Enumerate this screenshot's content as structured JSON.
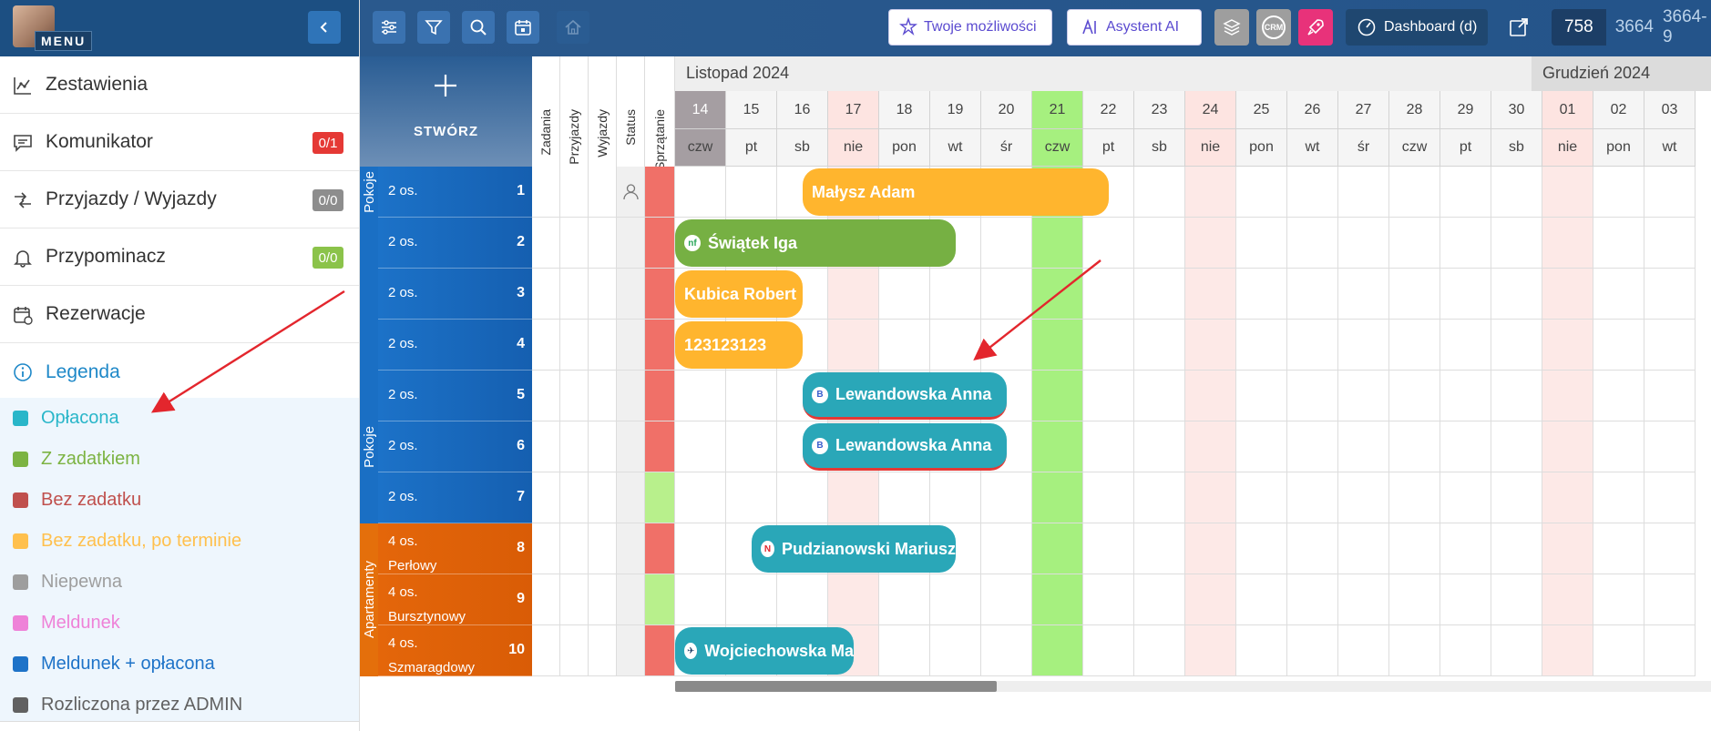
{
  "sidebar": {
    "menu_label": "MENU",
    "nav": [
      {
        "label": "Zestawienia",
        "icon": "chart-icon",
        "badge": ""
      },
      {
        "label": "Komunikator",
        "icon": "chat-icon",
        "badge": "0/1",
        "badge_color": "#e53935"
      },
      {
        "label": "Przyjazdy / Wyjazdy",
        "icon": "arrivals-icon",
        "badge": "0/0",
        "badge_color": "#8d8d8d"
      },
      {
        "label": "Przypominacz",
        "icon": "bell-icon",
        "badge": "0/0",
        "badge_color": "#8bc34a"
      },
      {
        "label": "Rezerwacje",
        "icon": "calendar-icon",
        "badge": ""
      }
    ],
    "legend_title": "Legenda",
    "legend": [
      {
        "label": "Opłacona",
        "color": "#29b6c9"
      },
      {
        "label": "Z zadatkiem",
        "color": "#7cb342"
      },
      {
        "label": "Bez zadatku",
        "color": "#c0504d"
      },
      {
        "label": "Bez zadatku, po terminie",
        "color": "#ffc04d"
      },
      {
        "label": "Niepewna",
        "color": "#9e9e9e"
      },
      {
        "label": "Meldunek",
        "color": "#ee82d8"
      },
      {
        "label": "Meldunek + opłacona",
        "color": "#1e73c8"
      },
      {
        "label": "Rozliczona przez ADMIN",
        "color": "#616161"
      }
    ]
  },
  "topbar": {
    "opportunities_label": "Twoje możliwości",
    "assistant_label": "Asystent AI",
    "crm_label": "CRM",
    "dashboard_label": "Dashboard (d)",
    "counters": [
      "758",
      "3664",
      "3664-9"
    ]
  },
  "calendar": {
    "create_label": "STWÓRZ",
    "side_columns": [
      "Zadania",
      "Przyjazdy",
      "Wyjazdy",
      "Status",
      "Sprzątanie"
    ],
    "months": [
      {
        "label": "Listopad 2024"
      },
      {
        "label": "Grudzień 2024"
      }
    ],
    "dates": [
      "14",
      "15",
      "16",
      "17",
      "18",
      "19",
      "20",
      "21",
      "22",
      "23",
      "24",
      "25",
      "26",
      "27",
      "28",
      "29",
      "30",
      "01",
      "02",
      "03"
    ],
    "weekdays": [
      "czw",
      "pt",
      "sb",
      "nie",
      "pon",
      "wt",
      "śr",
      "czw",
      "pt",
      "sb",
      "nie",
      "pon",
      "wt",
      "śr",
      "czw",
      "pt",
      "sb",
      "nie",
      "pon",
      "wt"
    ],
    "groups": [
      {
        "label": "Pokoje"
      },
      {
        "label": "Pokoje"
      },
      {
        "label": "Apartamenty"
      }
    ],
    "rooms": [
      {
        "cap": "2 os.",
        "name": "",
        "num": "1",
        "clean": "#f07068"
      },
      {
        "cap": "2 os.",
        "name": "",
        "num": "2",
        "clean": "#f07068"
      },
      {
        "cap": "2 os.",
        "name": "",
        "num": "3",
        "clean": "#f07068"
      },
      {
        "cap": "2 os.",
        "name": "",
        "num": "4",
        "clean": "#f07068"
      },
      {
        "cap": "2 os.",
        "name": "",
        "num": "5",
        "clean": "#f07068"
      },
      {
        "cap": "2 os.",
        "name": "",
        "num": "6",
        "clean": "#f07068"
      },
      {
        "cap": "2 os.",
        "name": "",
        "num": "7",
        "clean": "#b8f08c"
      },
      {
        "cap": "4 os.",
        "name": "Perłowy",
        "num": "8",
        "clean": "#f07068"
      },
      {
        "cap": "4 os.",
        "name": "Bursztynowy",
        "num": "9",
        "clean": "#b8f08c"
      },
      {
        "cap": "4 os.",
        "name": "Szmaragdowy",
        "num": "10",
        "clean": "#f07068"
      }
    ],
    "reservations": [
      {
        "guest": "Małysz Adam",
        "room": 0,
        "start": 2.5,
        "end": 8.5,
        "color": "#ffb52e",
        "source": ""
      },
      {
        "guest": "Świątek Iga",
        "room": 1,
        "start": 0,
        "end": 5.5,
        "color": "#76b043",
        "source": "nf"
      },
      {
        "guest": "Kubica Robert",
        "room": 2,
        "start": 0,
        "end": 2.5,
        "color": "#ffb52e",
        "source": ""
      },
      {
        "guest": "123123123",
        "room": 3,
        "start": 0,
        "end": 2.5,
        "color": "#ffb52e",
        "source": ""
      },
      {
        "guest": "Lewandowska Anna",
        "room": 4,
        "start": 2.5,
        "end": 6.5,
        "color": "#2aa7b8",
        "source": "B"
      },
      {
        "guest": "Lewandowska Anna",
        "room": 5,
        "start": 2.5,
        "end": 6.5,
        "color": "#2aa7b8",
        "source": "B"
      },
      {
        "guest": "Pudzianowski Mariusz",
        "room": 7,
        "start": 1.5,
        "end": 5.5,
        "color": "#2aa7b8",
        "source": "N"
      },
      {
        "guest": "Wojciechowska Ma",
        "room": 9,
        "start": 0,
        "end": 3.5,
        "color": "#2aa7b8",
        "source": "✈"
      }
    ]
  }
}
